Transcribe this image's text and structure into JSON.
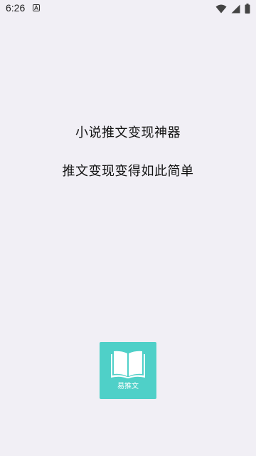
{
  "status_bar": {
    "time": "6:26",
    "icons": [
      "notification-a-icon",
      "wifi-icon",
      "signal-icon",
      "battery-icon"
    ]
  },
  "headline": {
    "line1": "小说推文变现神器",
    "line2": "推文变现变得如此简单"
  },
  "app": {
    "name": "易推文",
    "icon": "book-icon",
    "brand_color": "#4fd0c8"
  },
  "colors": {
    "background": "#f1eff5"
  }
}
